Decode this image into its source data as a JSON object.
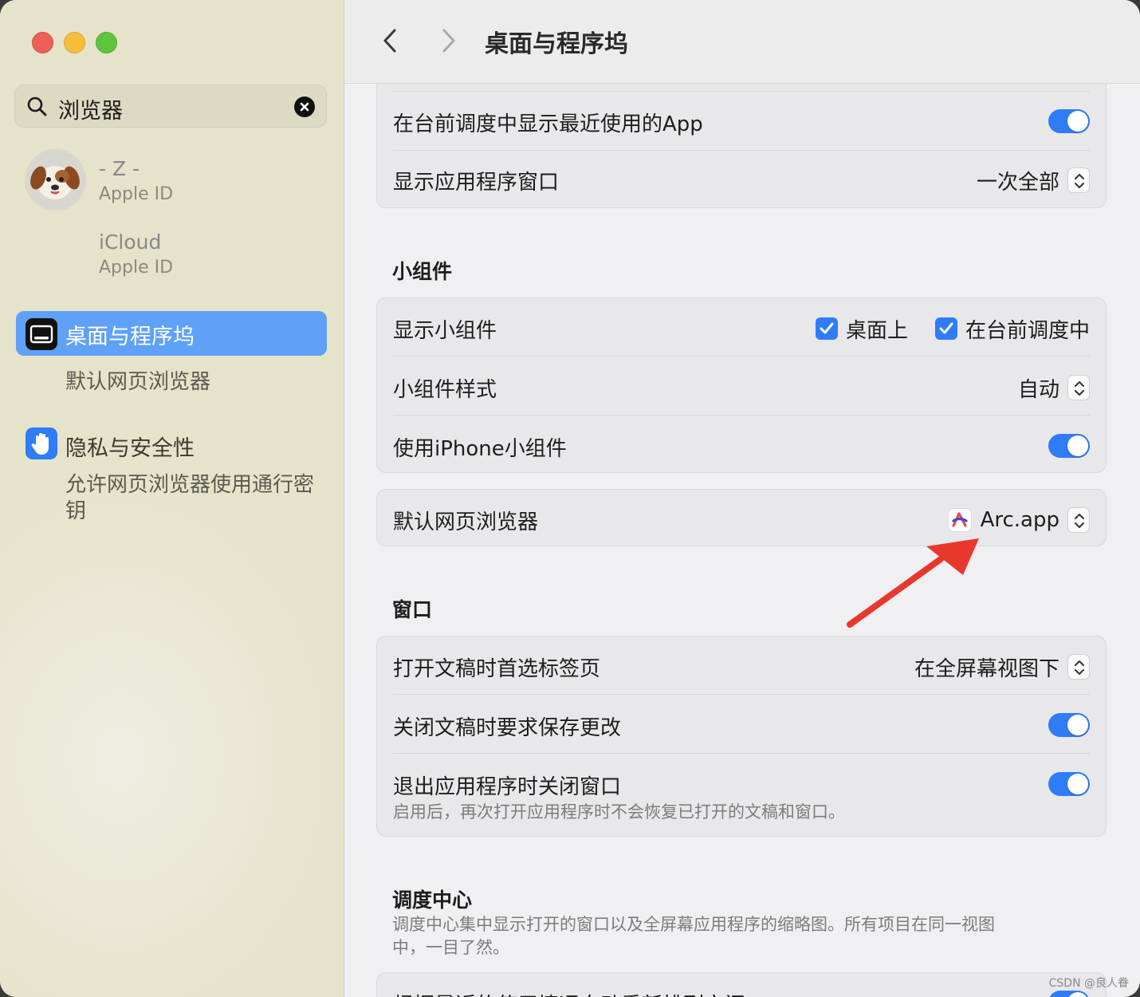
{
  "window": {
    "title": "桌面与程序坞"
  },
  "sidebar": {
    "search": {
      "value": "浏览器"
    },
    "account": {
      "name": "- Z -",
      "subtitle": "Apple ID"
    },
    "icloud": {
      "name": "iCloud",
      "subtitle": "Apple ID"
    },
    "items": [
      {
        "label": "桌面与程序坞",
        "selected": true,
        "icon": "dock-icon"
      },
      {
        "label": "默认网页浏览器"
      },
      {
        "label": "隐私与安全性",
        "icon": "hand-icon"
      },
      {
        "label": "允许网页浏览器使用通行密钥"
      }
    ]
  },
  "main": {
    "stage_manager": {
      "show_recent_apps": {
        "label": "在台前调度中显示最近使用的App",
        "on": true
      },
      "show_windows": {
        "label": "显示应用程序窗口",
        "value": "一次全部"
      }
    },
    "widgets": {
      "title": "小组件",
      "show_widgets": {
        "label": "显示小组件",
        "option1": "桌面上",
        "option2": "在台前调度中"
      },
      "widget_style": {
        "label": "小组件样式",
        "value": "自动"
      },
      "iphone_widgets": {
        "label": "使用iPhone小组件",
        "on": true
      }
    },
    "browser": {
      "label": "默认网页浏览器",
      "value": "Arc.app"
    },
    "windows": {
      "title": "窗口",
      "prefer_tabs": {
        "label": "打开文稿时首选标签页",
        "value": "在全屏幕视图下"
      },
      "ask_save": {
        "label": "关闭文稿时要求保存更改",
        "on": true
      },
      "close_windows": {
        "label": "退出应用程序时关闭窗口",
        "desc": "启用后，再次打开应用程序时不会恢复已打开的文稿和窗口。",
        "on": true
      }
    },
    "mission_control": {
      "title": "调度中心",
      "desc": "调度中心集中显示打开的窗口以及全屏幕应用程序的缩略图。所有项目在同一视图中，一目了然。",
      "first_row": "根据最近的使用情况自动重新排列空间"
    }
  },
  "watermark": "CSDN @良人眷",
  "colors": {
    "accent": "#2f7cf6",
    "sidebar_selected": "#5ea1f7",
    "annotation_arrow": "#e8382d"
  }
}
